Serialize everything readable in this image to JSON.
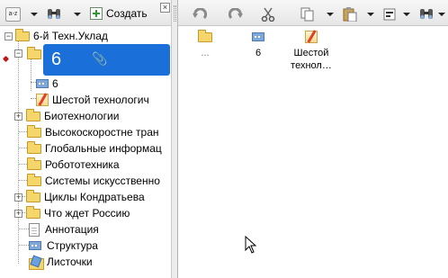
{
  "left_toolbar": {
    "sort_icon_text": "a-z",
    "create_label": "Создать"
  },
  "tree": {
    "root": {
      "label": "6-й Техн.Уклад"
    },
    "selected": {
      "label": "6"
    },
    "children_of_selected": [
      {
        "label": "6",
        "icon": "structure-icon"
      },
      {
        "label": "Шестой технологич",
        "icon": "pencil-note-icon"
      }
    ],
    "items": [
      {
        "label": "Биотехнологии",
        "expandable": true
      },
      {
        "label": "Высокоскоростне тран",
        "expandable": false
      },
      {
        "label": "Глобальные информац",
        "expandable": false
      },
      {
        "label": "Робототехника",
        "expandable": false
      },
      {
        "label": "Системы искусственно",
        "expandable": false
      },
      {
        "label": "Циклы Кондратьева",
        "expandable": true
      },
      {
        "label": "Что ждет Россию",
        "expandable": true
      }
    ],
    "bottom_items": [
      {
        "label": "Аннотация",
        "icon": "document-icon"
      },
      {
        "label": "Структура",
        "icon": "structure-icon"
      },
      {
        "label": "Листочки",
        "icon": "sticky-notes-icon"
      }
    ]
  },
  "content": {
    "items": [
      {
        "caption": "...",
        "caption2": "",
        "icon": "folder-icon"
      },
      {
        "caption": "6",
        "caption2": "",
        "icon": "structure-icon"
      },
      {
        "caption": "Шестой",
        "caption2": "технол…",
        "icon": "pencil-note-icon"
      }
    ]
  },
  "colors": {
    "selection": "#1a6fd8",
    "folder": "#f5d66a",
    "bookmark": "#c01818"
  }
}
